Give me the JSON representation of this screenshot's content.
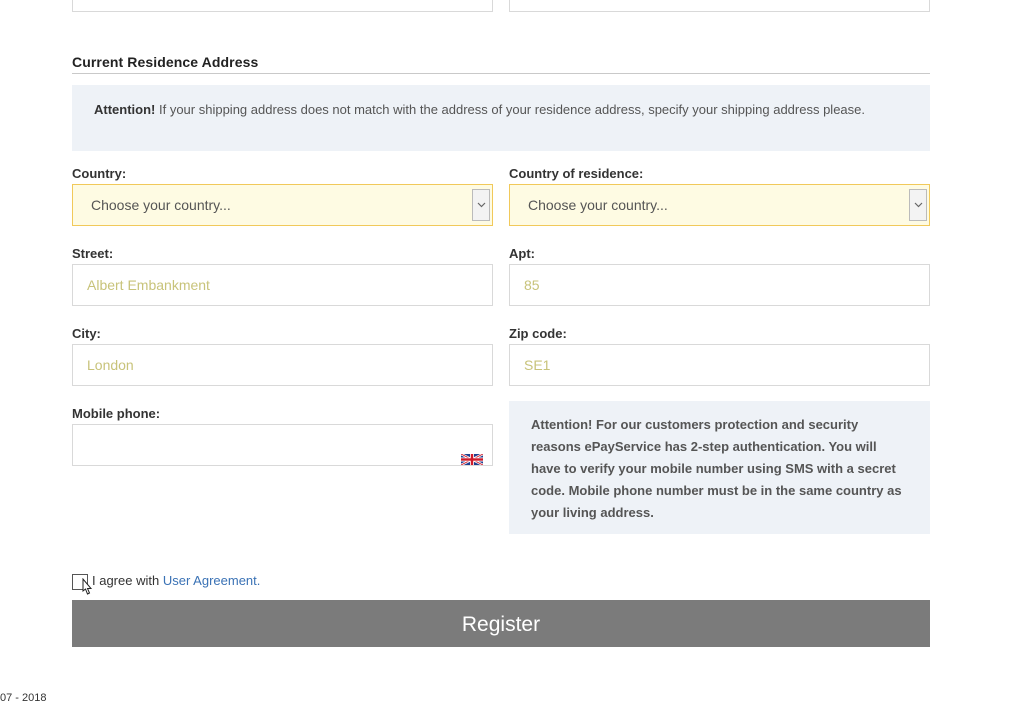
{
  "section": {
    "title": "Current Residence Address"
  },
  "notice": {
    "bold": "Attention!",
    "text": " If your shipping address does not match with the address of your residence address, specify your shipping address please."
  },
  "fields": {
    "country": {
      "label": "Country:",
      "placeholder": "Choose your country..."
    },
    "residence": {
      "label": "Country of residence:",
      "placeholder": "Choose your country..."
    },
    "street": {
      "label": "Street:",
      "placeholder": "Albert Embankment"
    },
    "apt": {
      "label": "Apt:",
      "placeholder": "85"
    },
    "city": {
      "label": "City:",
      "placeholder": "London"
    },
    "zip": {
      "label": "Zip code:",
      "placeholder": "SE1"
    },
    "mobile": {
      "label": "Mobile phone:",
      "value": ""
    }
  },
  "info": {
    "text": "Attention! For our customers protection and security reasons ePayService has 2-step authentication. You will have to verify your mobile number using SMS with a secret code. Mobile phone number must be in the same country as your living address."
  },
  "agree": {
    "prefix": "I agree with ",
    "link": "User Agreement."
  },
  "register": {
    "label": "Register"
  },
  "footer": {
    "text": "07 - 2018"
  },
  "icons": {
    "flag": "uk-flag-icon",
    "dropdown": "chevron-down-icon",
    "cursor": "pointer-cursor-icon"
  }
}
